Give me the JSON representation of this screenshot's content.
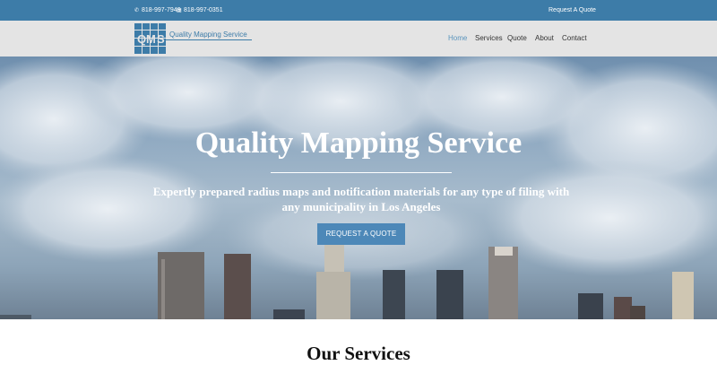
{
  "topbar": {
    "phone": "818-997-7949",
    "fax": "818-997-0351",
    "quote_link": "Request A Quote",
    "bg_color": "#3d7ca8"
  },
  "header": {
    "logo_letters": [
      "Q",
      "M",
      "S"
    ],
    "logo_text": "Quality Mapping Service",
    "nav": [
      {
        "label": "Home",
        "active": true
      },
      {
        "label": "Services",
        "active": false
      },
      {
        "label": "Quote",
        "active": false
      },
      {
        "label": "About",
        "active": false
      },
      {
        "label": "Contact",
        "active": false
      }
    ]
  },
  "hero": {
    "title": "Quality Mapping Service",
    "subtitle": "Expertly prepared radius maps and notification materials for any type of filing with any municipality in Los Angeles",
    "button_label": "REQUEST A QUOTE",
    "button_color": "#4d88b8"
  },
  "services": {
    "title": "Our Services"
  }
}
